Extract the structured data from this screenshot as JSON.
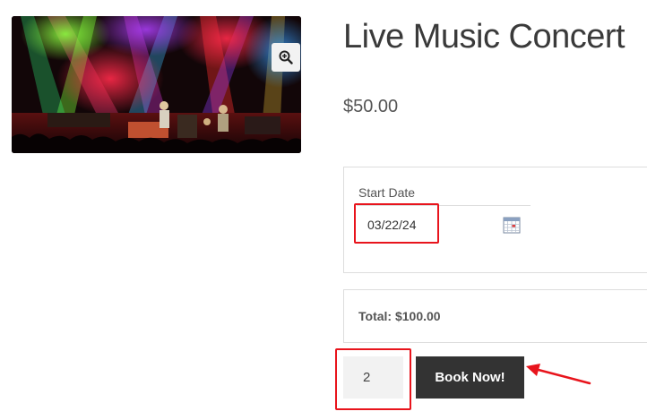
{
  "product": {
    "title": "Live Music Concert",
    "price": "$50.00",
    "image_alt": "concert-stage-photo"
  },
  "booking": {
    "start_date_label": "Start Date",
    "start_date_value": "03/22/24",
    "total_text": "Total: $100.00",
    "quantity": "2",
    "book_button_label": "Book Now!"
  },
  "icons": {
    "zoom": "magnifier-plus-icon",
    "calendar": "calendar-icon"
  },
  "colors": {
    "annotation_red": "#e8141c",
    "button_dark": "#333333"
  }
}
